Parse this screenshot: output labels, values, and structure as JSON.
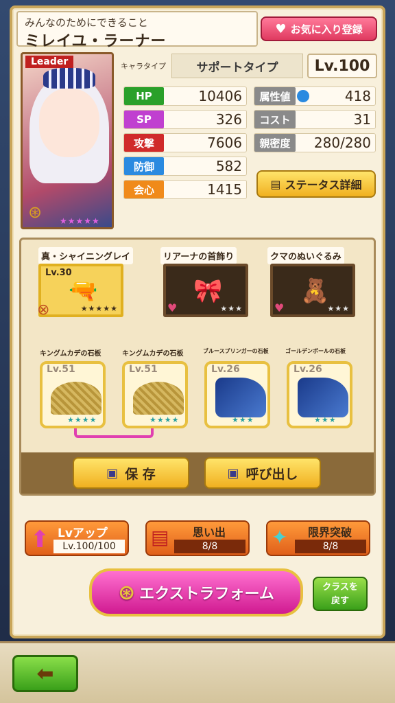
{
  "header": {
    "subtitle": "みんなのためにできること",
    "name": "ミレイユ・ラーナー",
    "favorite_label": "お気に入り登録"
  },
  "portrait": {
    "leader_label": "Leader",
    "rarity_stars": "★★★★★"
  },
  "profile": {
    "chara_type_label": "キャラタイプ",
    "chara_type_value": "サポートタイプ",
    "level": "Lv.100"
  },
  "stats_left": [
    {
      "label": "HP",
      "value": "10406",
      "color": "#2aa02a"
    },
    {
      "label": "SP",
      "value": "326",
      "color": "#c040d0"
    },
    {
      "label": "攻撃",
      "value": "7606",
      "color": "#d02a2a"
    },
    {
      "label": "防御",
      "value": "582",
      "color": "#2a8ae0"
    },
    {
      "label": "会心",
      "value": "1415",
      "color": "#f08a1a"
    }
  ],
  "stats_right": [
    {
      "label": "属性値",
      "value": "418"
    },
    {
      "label": "コスト",
      "value": "31"
    },
    {
      "label": "親密度",
      "value": "280/280"
    }
  ],
  "status_detail_label": "ステータス詳細",
  "equipment": [
    {
      "name": "真・シャイニングレイ",
      "level": "Lv.30",
      "stars": "★★★★★",
      "icon": "gun-icon"
    },
    {
      "name": "リアーナの首飾り",
      "stars": "★★★",
      "icon": "ribbon-necklace-icon"
    },
    {
      "name": "クマのぬいぐるみ",
      "stars": "★★★",
      "icon": "teddy-bear-icon"
    }
  ],
  "stones": [
    {
      "name": "キングムカデの石板",
      "level": "Lv.51",
      "stars": "★★★★",
      "style": "gold"
    },
    {
      "name": "キングムカデの石板",
      "level": "Lv.51",
      "stars": "★★★★",
      "style": "gold"
    },
    {
      "name": "ブルースプリンガーの石板",
      "level": "Lv.26",
      "stars": "★★★",
      "style": "blue"
    },
    {
      "name": "ゴールデンボールの石板",
      "level": "Lv.26",
      "stars": "★★★",
      "style": "blue"
    }
  ],
  "actions": {
    "save_label": "保 存",
    "call_label": "呼び出し"
  },
  "growth": {
    "lvup_label": "Lvアップ",
    "lvup_value": "Lv.100/100",
    "memory_label": "思い出",
    "memory_value": "8/8",
    "limit_label": "限界突破",
    "limit_value": "8/8"
  },
  "extra_form_label": "エクストラフォーム",
  "class_back_label_1": "クラスを",
  "class_back_label_2": "戻す",
  "back_arrow": "⬅"
}
